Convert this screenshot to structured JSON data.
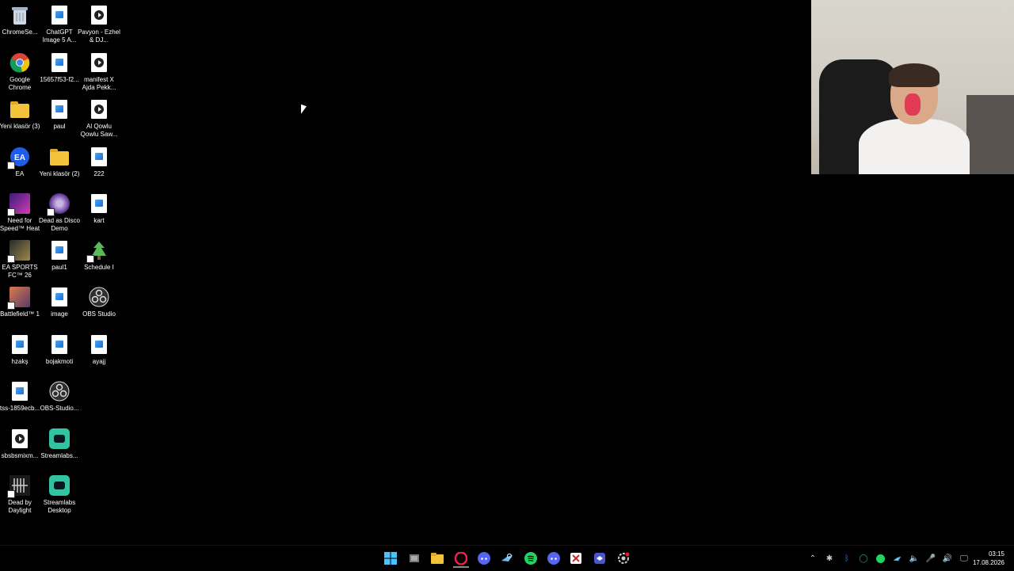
{
  "desktop": {
    "icons": [
      {
        "label": "ChromeSe...",
        "kind": "recycle"
      },
      {
        "label": "ChatGPT Image 5 A...",
        "kind": "file"
      },
      {
        "label": "Pavyon - Ezhel & DJ...",
        "kind": "video"
      },
      {
        "label": "Google Chrome",
        "kind": "chrome"
      },
      {
        "label": "15657f53-f2...",
        "kind": "file"
      },
      {
        "label": "manifest X Ajda Pekk...",
        "kind": "video"
      },
      {
        "label": "Yeni klasör (3)",
        "kind": "folder"
      },
      {
        "label": "paul",
        "kind": "file"
      },
      {
        "label": "Al Qowlu Qowlu Saw...",
        "kind": "video"
      },
      {
        "label": "EA",
        "kind": "ea"
      },
      {
        "label": "Yeni klasör (2)",
        "kind": "folder"
      },
      {
        "label": "222",
        "kind": "file"
      },
      {
        "label": "Need for Speed™ Heat",
        "kind": "game"
      },
      {
        "label": "Dead as Disco Demo",
        "kind": "game"
      },
      {
        "label": "kart",
        "kind": "file"
      },
      {
        "label": "EA SPORTS FC™ 26",
        "kind": "game"
      },
      {
        "label": "paul1",
        "kind": "file"
      },
      {
        "label": "Schedule I",
        "kind": "game"
      },
      {
        "label": "Battlefield™ 1",
        "kind": "game"
      },
      {
        "label": "image",
        "kind": "file"
      },
      {
        "label": "OBS Studio",
        "kind": "obs"
      },
      {
        "label": "hzakş",
        "kind": "file"
      },
      {
        "label": "bojakmoti",
        "kind": "file"
      },
      {
        "label": "ayajj",
        "kind": "file"
      },
      {
        "label": "tss-1859ecb...",
        "kind": "file"
      },
      {
        "label": "OBS-Studio...",
        "kind": "obs"
      },
      {
        "label": "sbsbsmixm...",
        "kind": "video"
      },
      {
        "label": "Streamlabs...",
        "kind": "streamlabs"
      },
      {
        "label": "Dead by Daylight",
        "kind": "game"
      },
      {
        "label": "Streamlabs Desktop",
        "kind": "streamlabs"
      }
    ]
  },
  "taskbar": {
    "apps": [
      {
        "name": "start-button",
        "icon": "windows-icon"
      },
      {
        "name": "task-view",
        "icon": "task-view-icon"
      },
      {
        "name": "file-explorer",
        "icon": "folder-icon"
      },
      {
        "name": "opera-gx",
        "icon": "opera-icon"
      },
      {
        "name": "discord",
        "icon": "discord-icon"
      },
      {
        "name": "steam",
        "icon": "steam-icon"
      },
      {
        "name": "spotify",
        "icon": "spotify-icon"
      },
      {
        "name": "discord-2",
        "icon": "discord-icon"
      },
      {
        "name": "snipping-tool",
        "icon": "snipping-icon"
      },
      {
        "name": "app",
        "icon": "app-icon"
      },
      {
        "name": "settings",
        "icon": "settings-icon"
      }
    ],
    "clock": {
      "time": "03:15",
      "date": "17.08.2026"
    }
  }
}
